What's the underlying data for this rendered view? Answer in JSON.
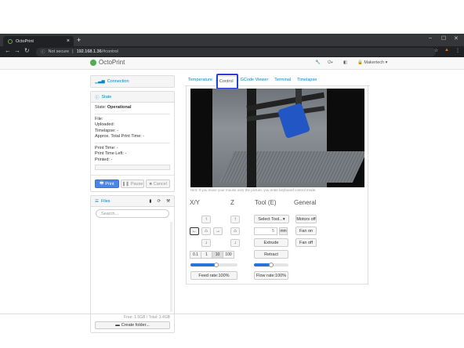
{
  "browser": {
    "tab_title": "OctoPrint",
    "security": "Not secure",
    "url_host": "192.168.1.36",
    "url_path": "/#control"
  },
  "app": {
    "brand": "OctoPrint",
    "user": "Makertech"
  },
  "sidebar": {
    "connection": "Connection",
    "state": {
      "title": "State",
      "label": "State:",
      "value": "Operational",
      "file": "File:",
      "uploaded": "Uploaded:",
      "timelapse": "Timelapse: -",
      "approx": "Approx. Total Print Time: -",
      "print_time": "Print Time: -",
      "print_time_left": "Print Time Left: -",
      "printed": "Printed: -"
    },
    "buttons": {
      "print": "Print",
      "pause": "Pause",
      "cancel": "Cancel"
    },
    "files": {
      "title": "Files",
      "search_placeholder": "Search...",
      "free": "Free: 1.5GB / Total: 3.4GB",
      "create_folder": "Create folder..."
    }
  },
  "tabs": [
    "Temperature",
    "Control",
    "GCode Viewer",
    "Terminal",
    "Timelapse"
  ],
  "control": {
    "hint": "Hint: If you move your mouse over the picture, you enter keyboard control mode.",
    "xy": "X/Y",
    "z": "Z",
    "tool": "Tool (E)",
    "general": "General",
    "steps": [
      "0.1",
      "1",
      "10",
      "100"
    ],
    "feed_rate": "Feed rate:100%",
    "flow_rate": "Flow rate:100%",
    "select_tool": "Select Tool...",
    "extrude_amount": "5",
    "mm": "mm",
    "extrude": "Extrude",
    "retract": "Retract",
    "motors_off": "Motors off",
    "fan_on": "Fan on",
    "fan_off": "Fan off",
    "feed_rate_level": 0.55,
    "flow_rate_level": 0.5
  },
  "colors": {
    "accent": "#0088cc",
    "primary": "#4a86e8",
    "highlight": "#2540d6"
  }
}
